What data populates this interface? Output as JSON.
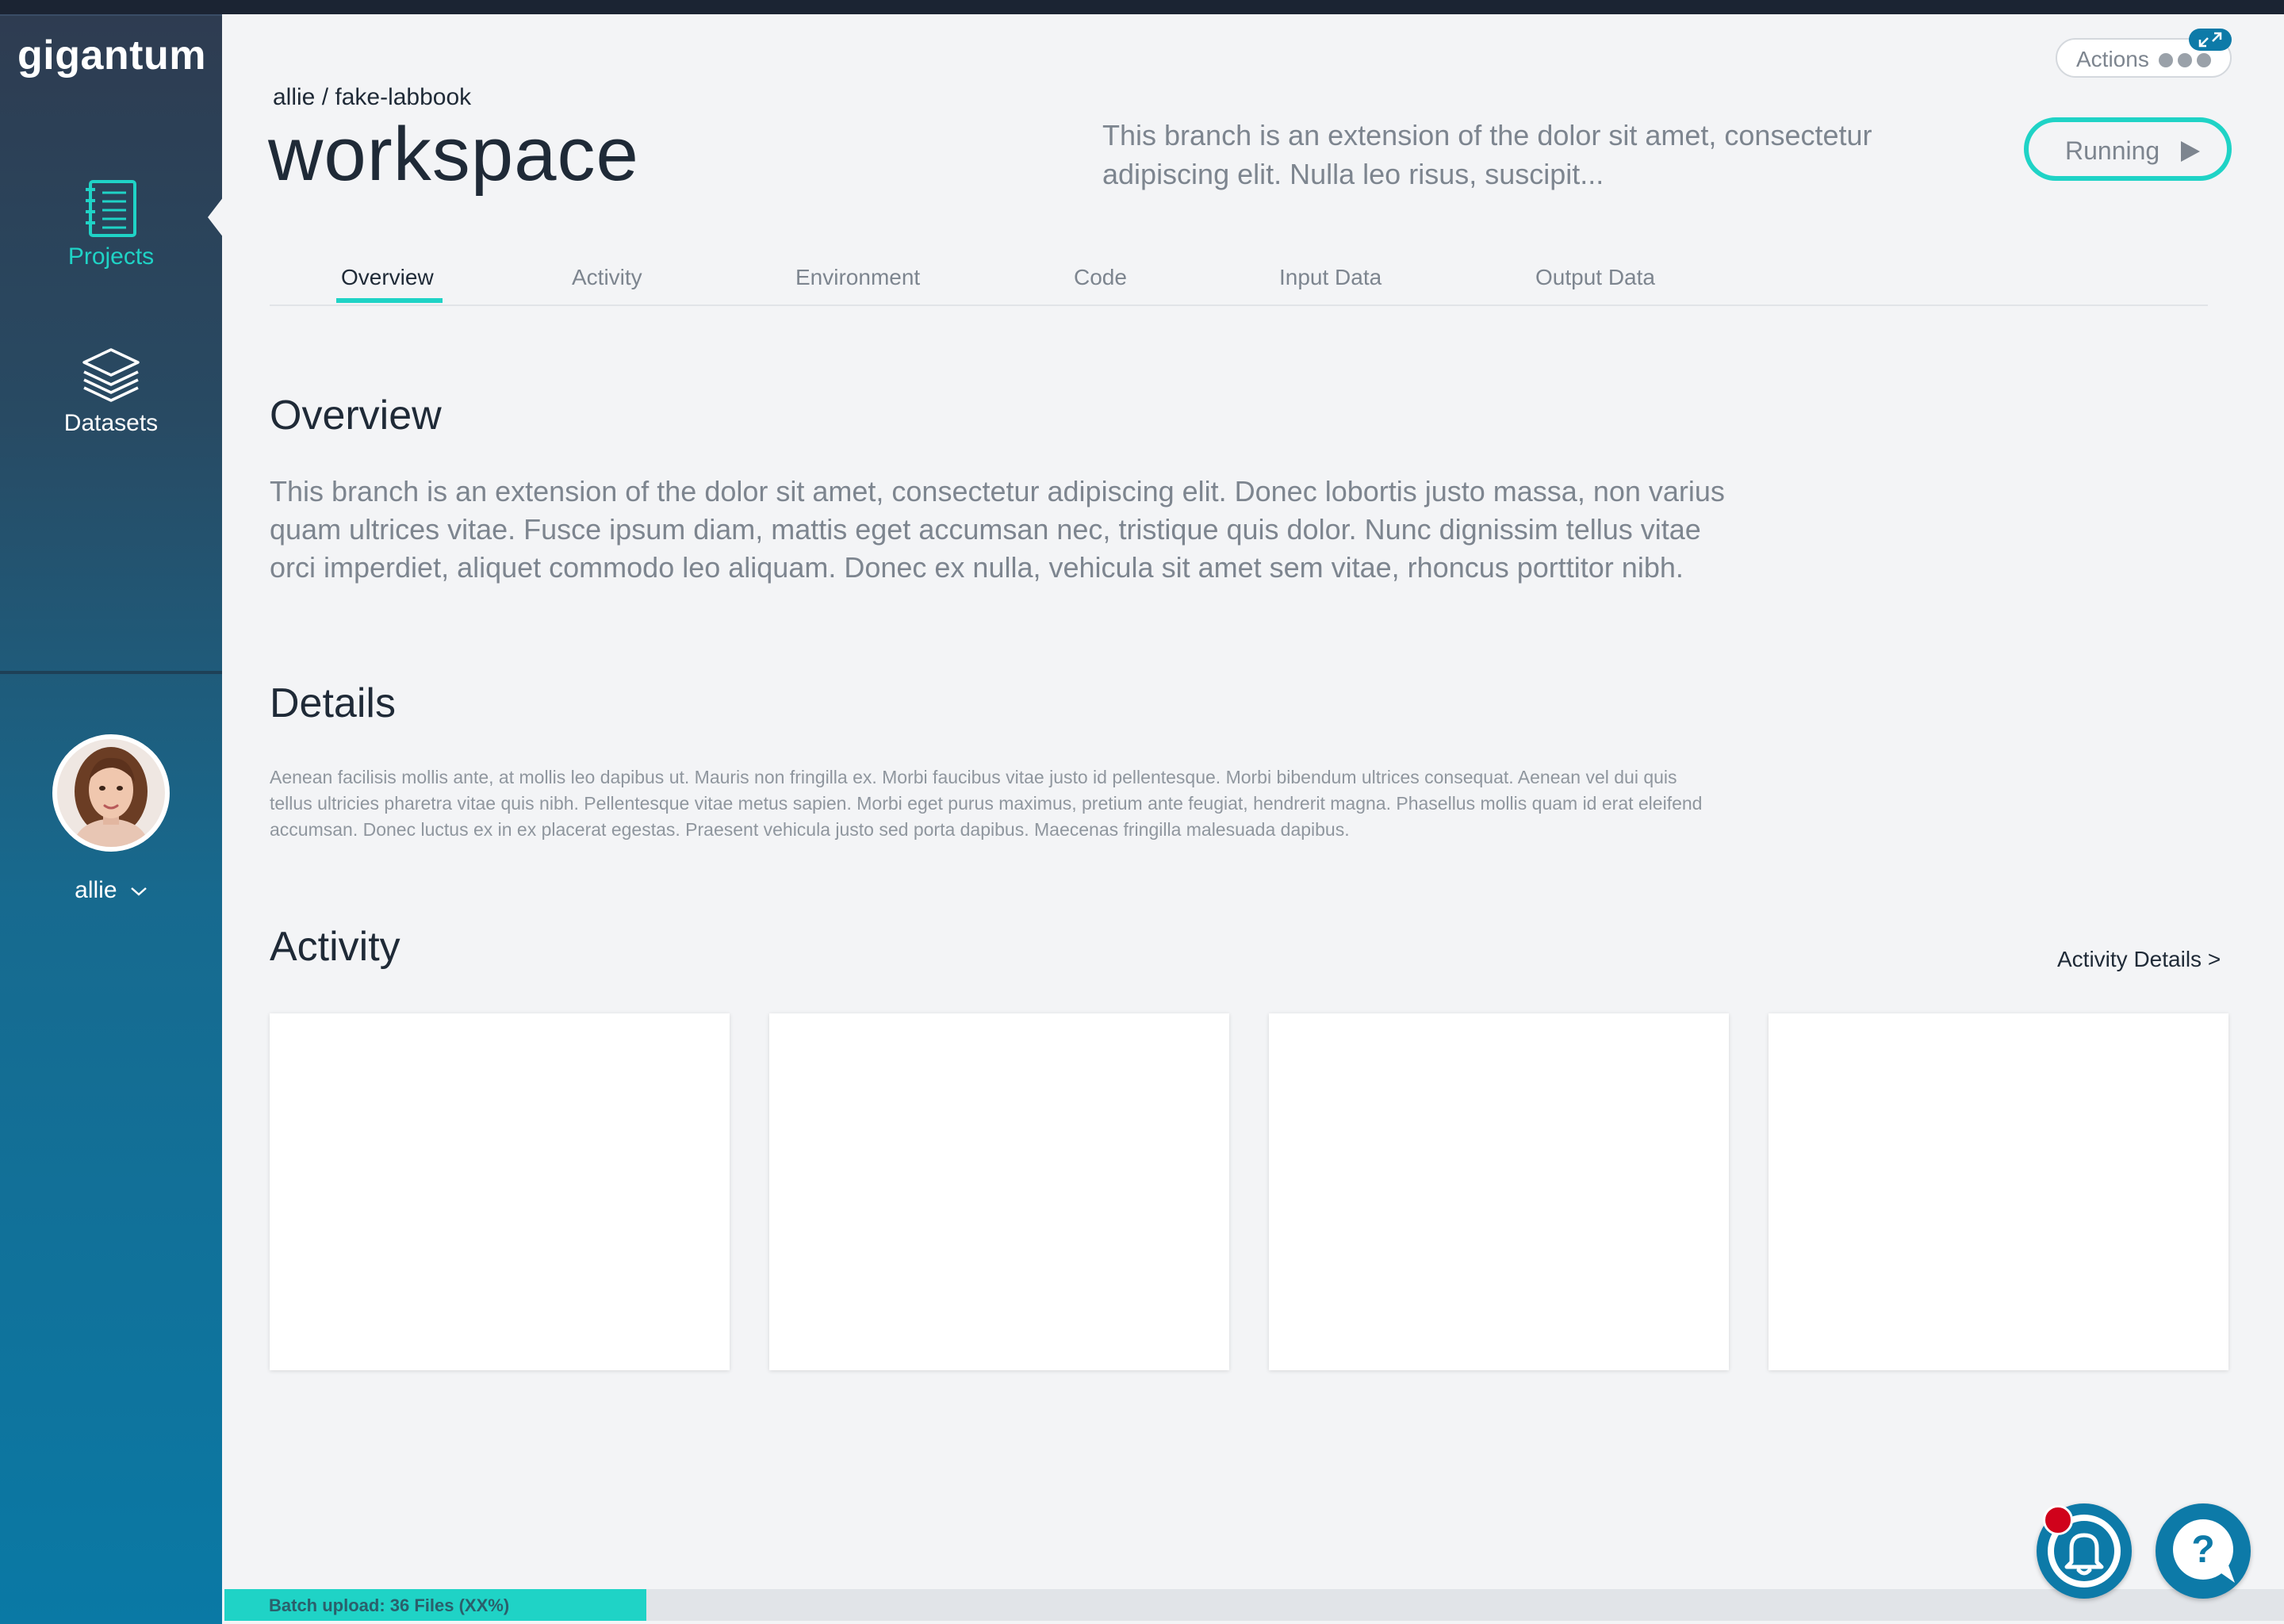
{
  "app": {
    "logo": "gigantum"
  },
  "sidebar": {
    "items": [
      {
        "label": "Projects",
        "icon": "notebook-icon",
        "active": true
      },
      {
        "label": "Datasets",
        "icon": "layers-icon",
        "active": false
      }
    ],
    "user": {
      "name": "allie",
      "avatar": "user-avatar-photo"
    }
  },
  "header": {
    "breadcrumb": "allie / fake-labbook",
    "title": "workspace",
    "description": "This branch is an extension of the dolor sit amet, consectetur adipiscing elit. Nulla leo risus, suscipit...",
    "actions_label": "Actions",
    "status_label": "Running"
  },
  "tabs": [
    {
      "label": "Overview",
      "active": true
    },
    {
      "label": "Activity",
      "active": false
    },
    {
      "label": "Environment",
      "active": false
    },
    {
      "label": "Code",
      "active": false
    },
    {
      "label": "Input Data",
      "active": false
    },
    {
      "label": "Output Data",
      "active": false
    }
  ],
  "overview": {
    "title": "Overview",
    "text": "This branch is an extension of the dolor sit amet, consectetur adipiscing elit. Donec lobortis justo massa, non varius quam ultrices vitae. Fusce ipsum diam, mattis eget accumsan nec, tristique quis dolor. Nunc dignissim tellus vitae orci imperdiet, aliquet commodo leo aliquam. Donec ex nulla, vehicula sit amet sem vitae, rhoncus porttitor nibh."
  },
  "details": {
    "title": "Details",
    "text": "Aenean facilisis mollis ante, at mollis leo dapibus ut. Mauris non fringilla ex. Morbi faucibus vitae justo id pellentesque. Morbi bibendum ultrices consequat. Aenean vel dui quis tellus ultricies pharetra vitae quis nibh. Pellentesque vitae metus sapien. Morbi eget purus maximus, pretium ante feugiat, hendrerit magna. Phasellus mollis quam id erat eleifend accumsan. Donec luctus ex in ex placerat egestas. Praesent vehicula justo sed porta dapibus. Maecenas fringilla malesuada dapibus."
  },
  "activity": {
    "title": "Activity",
    "details_link": "Activity Details >",
    "cards": [
      {},
      {},
      {},
      {}
    ]
  },
  "upload": {
    "label": "Batch upload: 36 Files (XX%)",
    "progress_fraction": 0.205
  },
  "colors": {
    "accent": "#1fd3c6",
    "primary": "#0d7aa8",
    "notification": "#d0021b"
  }
}
